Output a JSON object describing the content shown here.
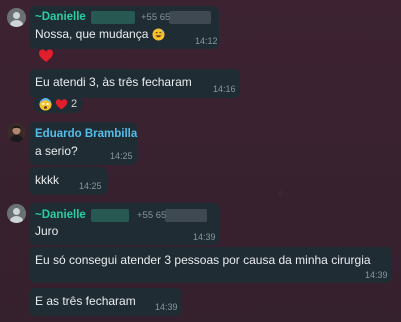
{
  "messages": {
    "m1": {
      "sender": "~Danielle",
      "phone": "+55 65",
      "text": "Nossa, que mudança",
      "emoji": "grinning-sweat-emoji",
      "time": "14:12",
      "reaction": "red-heart-emoji"
    },
    "m2": {
      "text": "Eu atendi 3, às três fecharam",
      "time": "14:16",
      "reactions": [
        "shocked-face-emoji",
        "red-heart-emoji"
      ],
      "reaction_count": "2"
    },
    "m3": {
      "sender": "Eduardo Brambilla",
      "text": "a serio?",
      "time": "14:25"
    },
    "m4": {
      "text": "kkkk",
      "time": "14:25"
    },
    "m5": {
      "sender": "~Danielle",
      "phone": "+55 65",
      "text": "Juro",
      "time": "14:39"
    },
    "m6": {
      "text": "Eu só consegui atender 3 pessoas por causa da minha cirurgia",
      "time": "14:39"
    },
    "m7": {
      "text": "E as três fecharam",
      "time": "14:39"
    }
  },
  "colors": {
    "background": "#3b2330",
    "bubble": "#202c33",
    "danielle_name": "#25d0a0",
    "eduardo_name": "#53bdeb",
    "timestamp": "#8696a0",
    "text": "#e9edef"
  }
}
